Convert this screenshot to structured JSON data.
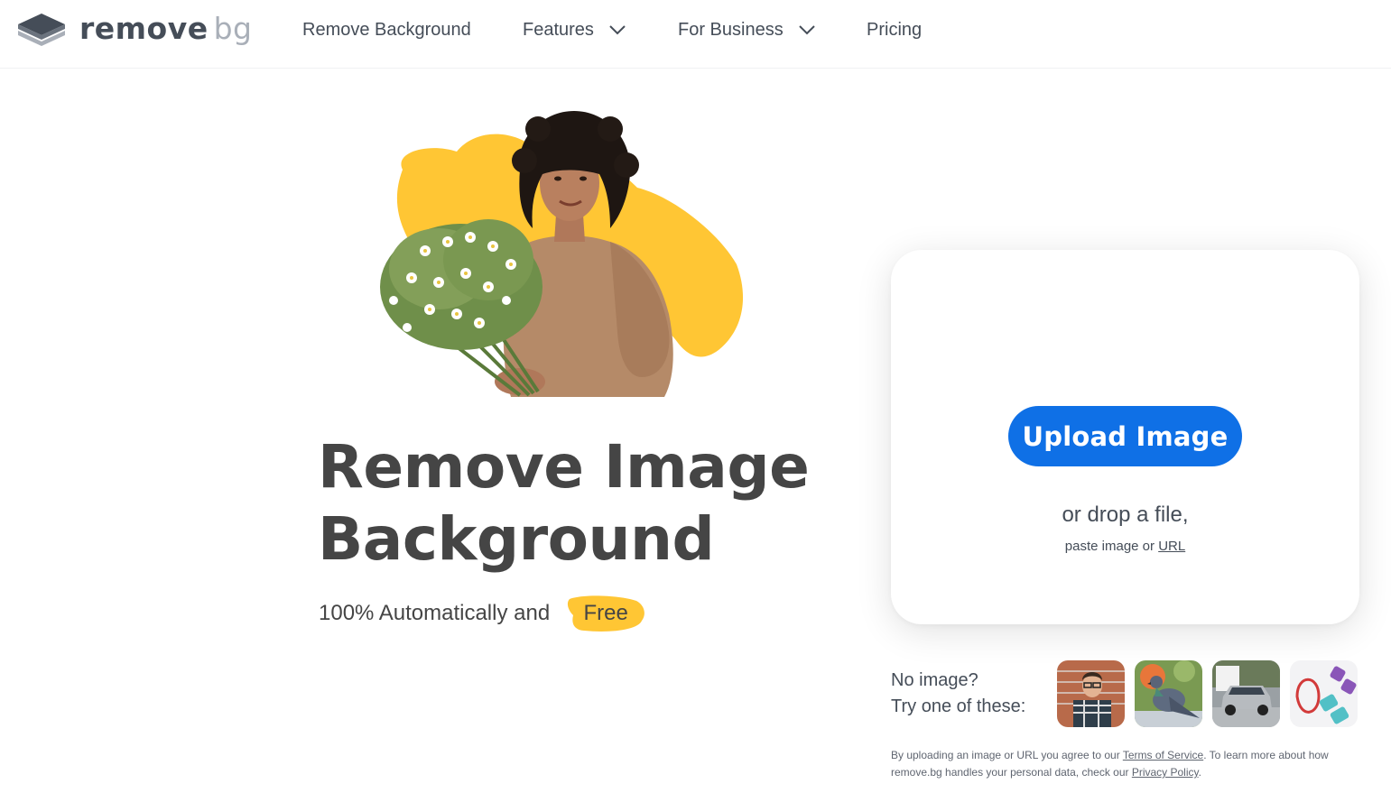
{
  "header": {
    "logo_word_main": "remove",
    "logo_word_accent": "bg",
    "nav": [
      {
        "label": "Remove Background"
      },
      {
        "label": "Features"
      },
      {
        "label": "For Business"
      },
      {
        "label": "Pricing"
      }
    ]
  },
  "hero": {
    "title_line1": "Remove Image",
    "title_line2": "Background",
    "subtitle": "100% Automatically and",
    "free_badge": "Free"
  },
  "upload": {
    "button_label": "Upload Image",
    "drop_text": "or drop a file,",
    "paste_prefix": "paste image or ",
    "url_link": "URL"
  },
  "samples": {
    "line1": "No image?",
    "line2": "Try one of these:",
    "thumbnails": [
      "person-sample",
      "pigeon-sample",
      "car-sample",
      "fitness-gear-sample"
    ]
  },
  "legal": {
    "part1": "By uploading an image or URL you agree to our ",
    "terms_link": "Terms of Service",
    "part2": ". To learn more about how remove.bg handles your personal data, check our ",
    "privacy_link": "Privacy Policy",
    "part3": "."
  },
  "colors": {
    "primary": "#0f70e6",
    "accent_yellow": "#ffc634",
    "text_dark": "#454545",
    "nav_text": "#454d58"
  }
}
